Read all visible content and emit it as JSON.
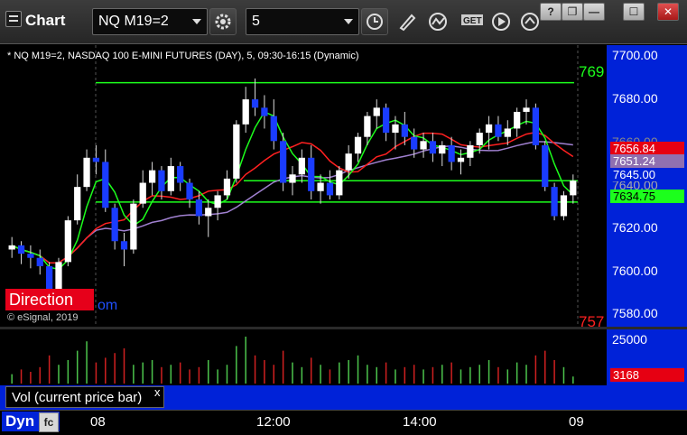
{
  "window": {
    "title": "Chart",
    "symbol_value": "NQ M19=2",
    "interval_value": "5",
    "buttons": {
      "help": "?",
      "restore": "❐",
      "minimize": "—",
      "maximize": "☐",
      "close": "✕"
    }
  },
  "chart": {
    "header": "* NQ M19=2, NASDAQ 100 E-MINI FUTURES (DAY), 5, 09:30-16:15 (Dynamic)",
    "direction_label": "Direction",
    "direction_tail": "om",
    "copyright": "© eSignal, 2019",
    "top_level_label": "769",
    "bottom_level_label": "757",
    "price_ticks": [
      "7700.00",
      "7680.00",
      "7660.00",
      "7640.00",
      "7620.00",
      "7600.00",
      "7580.00"
    ],
    "price_tags": [
      "7656.84",
      "7651.24",
      "7645.00",
      "7634.75"
    ],
    "time_ticks": [
      "08",
      "12:00",
      "14:00",
      "09"
    ]
  },
  "volume": {
    "label": "Vol (current price bar)",
    "close_icon": "x",
    "axis_tick": "25000",
    "current_value": "3168"
  },
  "footer": {
    "dyn_label": "Dyn",
    "lock_icon": "fc"
  },
  "colors": {
    "up": "#ffffff",
    "down": "#1a3cff",
    "ma_fast": "#1cff1c",
    "ma_slow": "#ff2020",
    "ma_avg": "#a080d0"
  },
  "chart_data": {
    "type": "candlestick",
    "title": "",
    "ylim": [
      7575,
      7710
    ],
    "levels": {
      "upper": 7692,
      "lower": 7574,
      "support": 7634.75,
      "close": 7645.0
    },
    "candles": [
      [
        7612,
        7618,
        7608,
        7614
      ],
      [
        7614,
        7616,
        7605,
        7610
      ],
      [
        7610,
        7614,
        7603,
        7608
      ],
      [
        7608,
        7612,
        7600,
        7604
      ],
      [
        7604,
        7606,
        7588,
        7592
      ],
      [
        7592,
        7608,
        7588,
        7606
      ],
      [
        7606,
        7628,
        7604,
        7626
      ],
      [
        7626,
        7648,
        7624,
        7642
      ],
      [
        7642,
        7660,
        7640,
        7656
      ],
      [
        7656,
        7662,
        7648,
        7654
      ],
      [
        7654,
        7660,
        7630,
        7632
      ],
      [
        7632,
        7634,
        7612,
        7616
      ],
      [
        7616,
        7620,
        7604,
        7612
      ],
      [
        7612,
        7636,
        7610,
        7634
      ],
      [
        7634,
        7650,
        7632,
        7644
      ],
      [
        7644,
        7654,
        7638,
        7650
      ],
      [
        7650,
        7652,
        7636,
        7640
      ],
      [
        7640,
        7656,
        7638,
        7652
      ],
      [
        7652,
        7654,
        7640,
        7644
      ],
      [
        7644,
        7646,
        7632,
        7636
      ],
      [
        7636,
        7640,
        7624,
        7628
      ],
      [
        7628,
        7636,
        7618,
        7632
      ],
      [
        7632,
        7640,
        7626,
        7638
      ],
      [
        7638,
        7650,
        7636,
        7646
      ],
      [
        7646,
        7674,
        7644,
        7672
      ],
      [
        7672,
        7690,
        7668,
        7684
      ],
      [
        7684,
        7694,
        7676,
        7680
      ],
      [
        7680,
        7686,
        7670,
        7676
      ],
      [
        7676,
        7684,
        7660,
        7664
      ],
      [
        7664,
        7668,
        7640,
        7644
      ],
      [
        7644,
        7652,
        7638,
        7648
      ],
      [
        7648,
        7660,
        7644,
        7656
      ],
      [
        7656,
        7662,
        7636,
        7640
      ],
      [
        7640,
        7648,
        7634,
        7644
      ],
      [
        7644,
        7650,
        7636,
        7638
      ],
      [
        7638,
        7652,
        7636,
        7650
      ],
      [
        7650,
        7662,
        7646,
        7658
      ],
      [
        7658,
        7668,
        7654,
        7666
      ],
      [
        7666,
        7678,
        7662,
        7676
      ],
      [
        7676,
        7684,
        7670,
        7680
      ],
      [
        7680,
        7682,
        7664,
        7668
      ],
      [
        7668,
        7676,
        7660,
        7672
      ],
      [
        7672,
        7678,
        7662,
        7666
      ],
      [
        7666,
        7670,
        7656,
        7660
      ],
      [
        7660,
        7668,
        7656,
        7664
      ],
      [
        7664,
        7668,
        7654,
        7658
      ],
      [
        7658,
        7664,
        7652,
        7662
      ],
      [
        7662,
        7666,
        7650,
        7654
      ],
      [
        7654,
        7660,
        7648,
        7656
      ],
      [
        7656,
        7664,
        7652,
        7662
      ],
      [
        7662,
        7670,
        7658,
        7668
      ],
      [
        7668,
        7676,
        7660,
        7672
      ],
      [
        7672,
        7676,
        7664,
        7666
      ],
      [
        7666,
        7674,
        7662,
        7670
      ],
      [
        7670,
        7680,
        7666,
        7678
      ],
      [
        7678,
        7684,
        7672,
        7680
      ],
      [
        7680,
        7682,
        7660,
        7662
      ],
      [
        7662,
        7664,
        7640,
        7642
      ],
      [
        7642,
        7644,
        7626,
        7628
      ],
      [
        7628,
        7640,
        7626,
        7638
      ],
      [
        7638,
        7648,
        7634,
        7645
      ]
    ],
    "volume": [
      4,
      6,
      5,
      7,
      12,
      8,
      10,
      14,
      18,
      9,
      11,
      13,
      15,
      8,
      9,
      10,
      7,
      8,
      9,
      6,
      7,
      10,
      6,
      8,
      16,
      20,
      12,
      10,
      8,
      14,
      9,
      7,
      11,
      8,
      6,
      9,
      10,
      12,
      8,
      7,
      9,
      6,
      7,
      8,
      6,
      7,
      8,
      9,
      6,
      7,
      8,
      10,
      7,
      6,
      9,
      8,
      12,
      14,
      10,
      7,
      3
    ]
  }
}
